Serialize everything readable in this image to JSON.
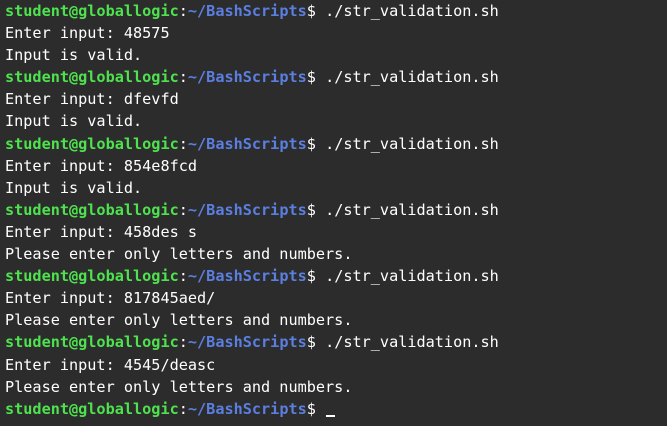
{
  "prompt": {
    "user_host": "student@globallogic",
    "colon": ":",
    "path": "~/BashScripts",
    "dollar": "$ "
  },
  "colors": {
    "background": "#2c2c2c",
    "user_host": "#4ee34e",
    "path": "#5b7fe0",
    "text": "#ffffff"
  },
  "runs": [
    {
      "command": "./str_validation.sh",
      "input_line": "Enter input: 48575",
      "result": "Input is valid."
    },
    {
      "command": "./str_validation.sh",
      "input_line": "Enter input: dfevfd",
      "result": "Input is valid."
    },
    {
      "command": "./str_validation.sh",
      "input_line": "Enter input: 854e8fcd",
      "result": "Input is valid."
    },
    {
      "command": "./str_validation.sh",
      "input_line": "Enter input: 458des s",
      "result": "Please enter only letters and numbers."
    },
    {
      "command": "./str_validation.sh",
      "input_line": "Enter input: 817845aed/",
      "result": "Please enter only letters and numbers."
    },
    {
      "command": "./str_validation.sh",
      "input_line": "Enter input: 4545/deasc",
      "result": "Please enter only letters and numbers."
    }
  ],
  "final_prompt": {
    "command": ""
  }
}
